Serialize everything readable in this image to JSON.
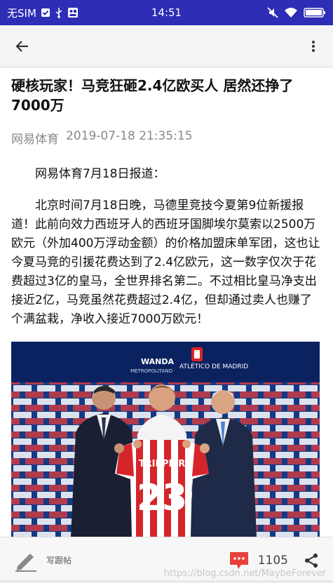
{
  "status_bar": {
    "carrier": "无SIM",
    "time": "14:51"
  },
  "article": {
    "title": "硬核玩家！马竞狂砸2.4亿欧买人 居然还挣了7000万",
    "source": "网易体育",
    "datetime": "2019-07-18 21:35:15",
    "paragraphs": [
      "网易体育7月18日报道：",
      "北京时间7月18日晚，马德里竞技今夏第9位新援报道！此前向效力西班牙人的西班牙国脚埃尔莫索以2500万欧元（外加400万浮动金额）的价格加盟床单军团，这也让今夏马竞的引援花费达到了2.4亿欧元，这一数字仅次于花费超过3亿的皇马，全世界排名第二。不过相比皇马净支出接近2亿，马竞虽然花费超过2.4亿，但却通过卖人也赚了个满盆栽，净收入接近7000万欧元！"
    ]
  },
  "photo": {
    "backdrop_text_1": "WANDA",
    "backdrop_text_2": "METROPOLITANO",
    "backdrop_text_3": "ATLÉTICO DE MADRID",
    "jersey_name": "TRIPPIER",
    "jersey_number": "23"
  },
  "bottom_bar": {
    "write_label": "写跟帖",
    "comment_count": "1105"
  },
  "watermark": "https://blog.csdn.net/MaybeForever",
  "colors": {
    "status_bar": "#2d2db5",
    "comment_badge": "#e8413b"
  }
}
